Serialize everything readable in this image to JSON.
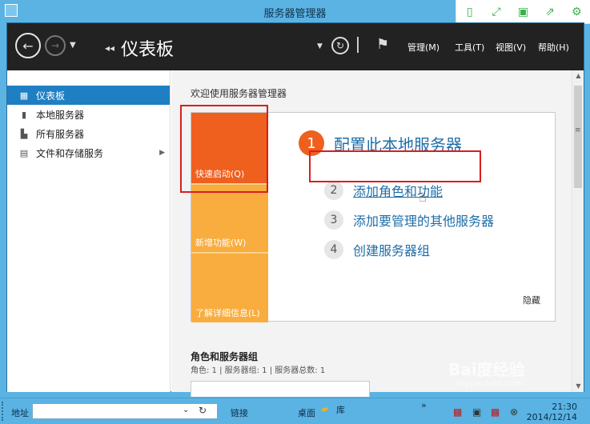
{
  "window": {
    "title": "服务器管理器"
  },
  "toolbox": {
    "icons": [
      "fit-icon",
      "expand-icon",
      "save-icon",
      "share-icon",
      "settings-icon"
    ]
  },
  "header": {
    "breadcrumb": "仪表板",
    "menus": [
      "管理(M)",
      "工具(T)",
      "视图(V)",
      "帮助(H)"
    ]
  },
  "sidebar": {
    "items": [
      {
        "label": "仪表板",
        "icon": "grid-icon",
        "active": true
      },
      {
        "label": "本地服务器",
        "icon": "server-icon"
      },
      {
        "label": "所有服务器",
        "icon": "servers-icon"
      },
      {
        "label": "文件和存储服务",
        "icon": "storage-icon",
        "has_submenu": true
      }
    ]
  },
  "content": {
    "welcome": "欢迎使用服务器管理器",
    "tiles": [
      "快速启动(Q)",
      "新增功能(W)",
      "了解详细信息(L)"
    ],
    "steps": [
      {
        "num": "1",
        "label": "配置此本地服务器"
      },
      {
        "num": "2",
        "label": "添加角色和功能"
      },
      {
        "num": "3",
        "label": "添加要管理的其他服务器"
      },
      {
        "num": "4",
        "label": "创建服务器组"
      }
    ],
    "hide": "隐藏",
    "roles_title": "角色和服务器组",
    "roles_subtitle": "角色: 1 | 服务器组: 1 | 服务器总数: 1"
  },
  "taskbar": {
    "address_label": "地址",
    "address_value": "",
    "links": "链接",
    "desktop": "桌面",
    "library": "库",
    "more": "»",
    "time": "21:30",
    "date": "2014/12/14"
  },
  "watermark": {
    "text": "Bai度经验",
    "sub": "jingyan.baidu.com"
  },
  "colors": {
    "accent": "#1f7fc3",
    "orange": "#ef5f1d",
    "tile": "#f8ad3e",
    "link": "#1e6ea8",
    "highlight": "#d81e1e"
  }
}
